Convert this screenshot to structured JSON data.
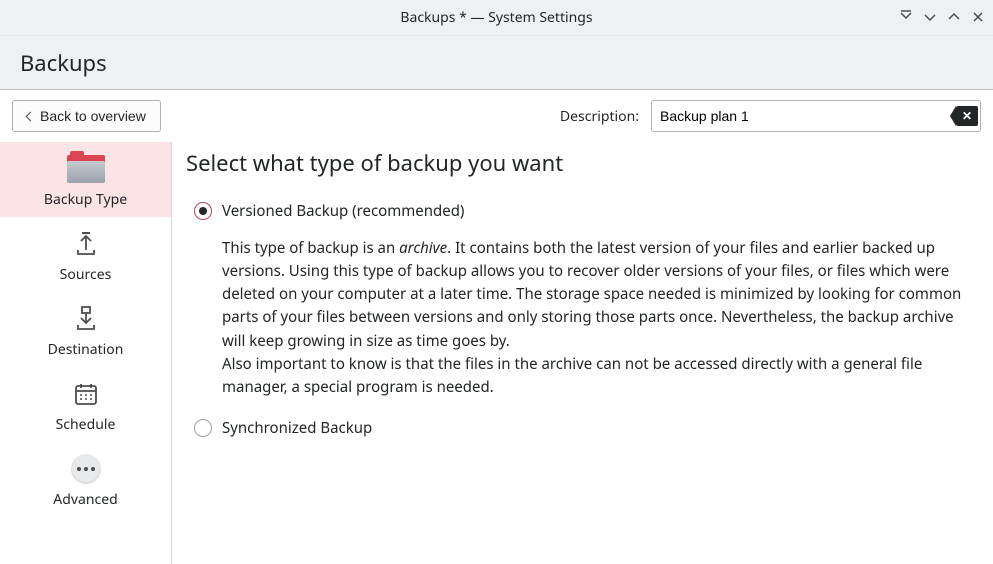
{
  "titlebar": {
    "title": "Backups * — System Settings"
  },
  "header": {
    "title": "Backups"
  },
  "toolbar": {
    "back_label": "Back to overview",
    "description_label": "Description:",
    "description_value": "Backup plan 1"
  },
  "sidebar": {
    "items": [
      {
        "id": "backup-type",
        "label": "Backup Type",
        "active": true
      },
      {
        "id": "sources",
        "label": "Sources",
        "active": false
      },
      {
        "id": "destination",
        "label": "Destination",
        "active": false
      },
      {
        "id": "schedule",
        "label": "Schedule",
        "active": false
      },
      {
        "id": "advanced",
        "label": "Advanced",
        "active": false
      }
    ]
  },
  "main": {
    "heading": "Select what type of backup you want",
    "options": [
      {
        "id": "versioned",
        "label": "Versioned Backup (recommended)",
        "selected": true,
        "description_pre": "This type of backup is an ",
        "description_em": "archive",
        "description_post": ". It contains both the latest version of your files and earlier backed up versions. Using this type of backup allows you to recover older versions of your files, or files which were deleted on your computer at a later time. The storage space needed is minimized by looking for common parts of your files between versions and only storing those parts once. Nevertheless, the backup archive will keep growing in size as time goes by.",
        "description_line2": "Also important to know is that the files in the archive can not be accessed directly with a general file manager, a special program is needed."
      },
      {
        "id": "synchronized",
        "label": "Synchronized Backup",
        "selected": false
      }
    ]
  }
}
